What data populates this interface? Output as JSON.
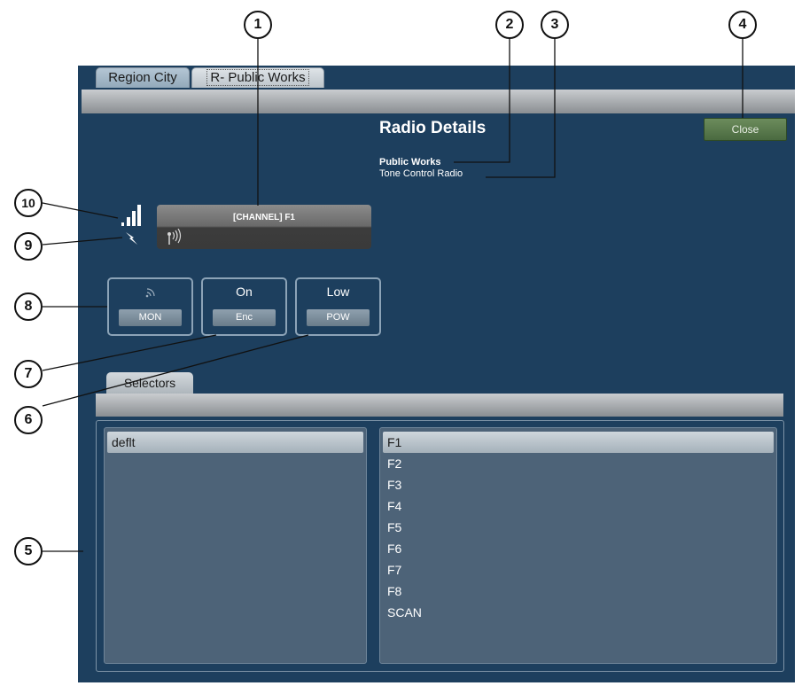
{
  "tabs": [
    {
      "label": "Region City",
      "active": false
    },
    {
      "label": "R- Public Works",
      "active": true
    }
  ],
  "header": {
    "title": "Radio Details",
    "close_label": "Close"
  },
  "radio": {
    "name": "Public Works",
    "type": "Tone Control Radio"
  },
  "channel": {
    "label": "[CHANNEL] F1"
  },
  "controls": [
    {
      "status": "",
      "button": "MON"
    },
    {
      "status": "On",
      "button": "Enc"
    },
    {
      "status": "Low",
      "button": "POW"
    }
  ],
  "selectors": {
    "tab_label": "Selectors",
    "left_list": [
      "deflt"
    ],
    "right_list": [
      "F1",
      "F2",
      "F3",
      "F4",
      "F5",
      "F6",
      "F7",
      "F8",
      "SCAN"
    ]
  },
  "callouts": [
    "1",
    "2",
    "3",
    "4",
    "5",
    "6",
    "7",
    "8",
    "9",
    "10"
  ],
  "colors": {
    "panel": "#1d3f5e",
    "close_button": "#5a7a4c"
  }
}
